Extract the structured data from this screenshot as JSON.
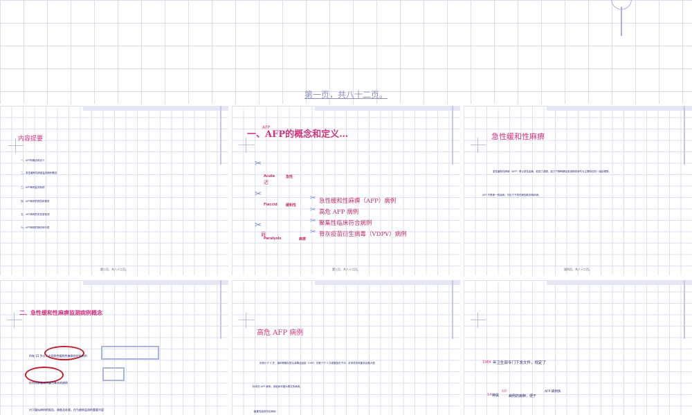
{
  "top": {
    "caption": "第一页，共八十二页。"
  },
  "slide2": {
    "title": "内容提要",
    "items": [
      "一、AFP的概念和定义",
      "二、急性缓和性麻痹监测病例概念",
      "三、AFP病例监测系统",
      "四、AFP病例的报告和调查",
      "五、AFP病例的实验室检测",
      "六、AFP病例的随访和分类"
    ],
    "footer": "第二页，共八十二页。"
  },
  "slide3": {
    "title": "一、AFP的概念和定义…",
    "title_sup": "AFP",
    "acute": "Acute",
    "acute_cn": "急性",
    "acute_sub": "迟",
    "flaccid": "Flaccid",
    "flaccid_cn": "缓和性",
    "paralysis": "Paralysis",
    "paralysis_cn": "麻痹",
    "paralysis_sub": "弱",
    "bullets": [
      "急性缓和性麻痹（AFP）病例",
      "高危 AFP 病例",
      "聚集性临床符合病例",
      "脊灰疫苗衍生病毒（VDPV）病例"
    ],
    "footer": "第三页，共八十二页。"
  },
  "slide4": {
    "title": "急性缓和性麻痹",
    "line1": "急性缓和性麻痹（AFP）是以急性起病、肌张力减弱、肌力下降和腱反射减弱或消失为主要特征的一组症候群。",
    "line2": "AFP 不是单一的疾病，可见于不同的病因和多种疾病。",
    "footer": "第四页，共八十二页。"
  },
  "slide5": {
    "title": "二、急性缓和性麻痹监测病例概念",
    "text1": "所有 15 岁以下出现急性缓和性麻痹症状的病例",
    "text2": "任何年龄临床怀疑为脊灰的病例",
    "text3": "对于疑似病例的报告、调查及处理，作为病例监测的重要内容"
  },
  "slide6": {
    "title": "高危 AFP 病例",
    "line1": "年龄小于 5 岁、接种脊髓灰质炎减毒活疫苗（OPV）次数少于 3 次或服苗史不详、未采或未采集到合格大便",
    "line2": "标本的 AFP 病例；或临床怀疑为脊灰的病例。",
    "line3": "聚集性临床符合病例"
  },
  "slide7": {
    "year": "1984",
    "line1": "年卫生部专门下发文件，规定了",
    "num": "14",
    "kinds": "种属",
    "afp_sup": "AFP",
    "line2": "病例的病种，便于",
    "afp_tail": "AFP 病例快"
  }
}
